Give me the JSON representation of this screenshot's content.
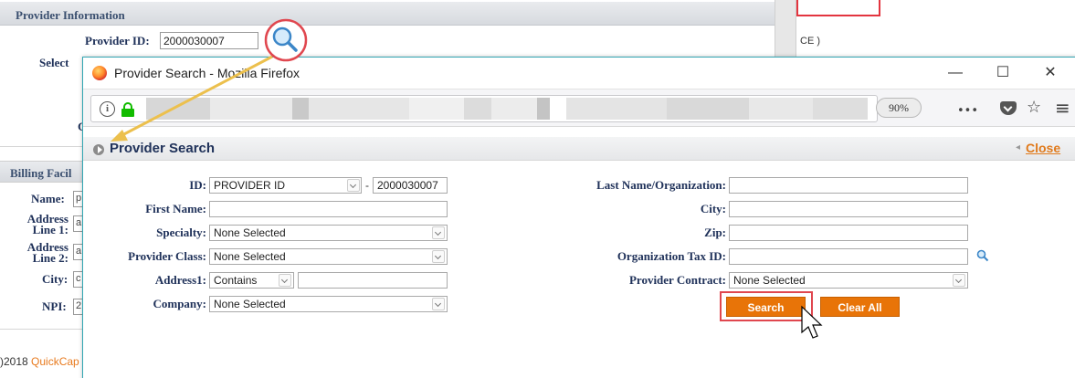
{
  "background_page": {
    "header_title": "Provider Information",
    "provider_id_label": "Provider ID:",
    "provider_id_value": "2000030007",
    "select_label": "Select",
    "right_suffix": "CE )",
    "c_stub": "C",
    "billing_header": "Billing Facil",
    "name_label": "Name:",
    "address1_label": "Address Line 1:",
    "address2_label": "Address Line 2:",
    "city_label": "City:",
    "npi_label": "NPI:",
    "name_stub": "p",
    "address1_stub": "a",
    "address2_stub": "a",
    "city_stub": "c",
    "npi_stub": "2",
    "copyright_prefix": ")2018 ",
    "copyright_brand": "QuickCap"
  },
  "browser": {
    "window_title": "Provider Search - Mozilla Firefox",
    "minimize": "—",
    "maximize": "☐",
    "close": "✕",
    "zoom": "90%",
    "more_icon": "•••",
    "star_icon": "☆",
    "menu_icon": "≡",
    "accent_color": "#12bc00"
  },
  "provider_search": {
    "title": "Provider Search",
    "close_link": "Close",
    "id_label": "ID:",
    "id_type": "PROVIDER ID",
    "id_separator": "-",
    "id_value": "2000030007",
    "first_name_label": "First Name:",
    "first_name_value": "",
    "specialty_label": "Specialty:",
    "specialty_value": "None Selected",
    "provider_class_label": "Provider Class:",
    "provider_class_value": "None Selected",
    "address1_label": "Address1:",
    "address1_mode": "Contains",
    "address1_value": "",
    "company_label": "Company:",
    "company_value": "None Selected",
    "last_name_label": "Last Name/Organization:",
    "last_name_value": "",
    "city_label": "City:",
    "city_value": "",
    "zip_label": "Zip:",
    "zip_value": "",
    "tax_id_label": "Organization Tax ID:",
    "tax_id_value": "",
    "contract_label": "Provider Contract:",
    "contract_value": "None Selected",
    "search_button": "Search",
    "clear_button": "Clear All",
    "button_color": "#e87408"
  }
}
